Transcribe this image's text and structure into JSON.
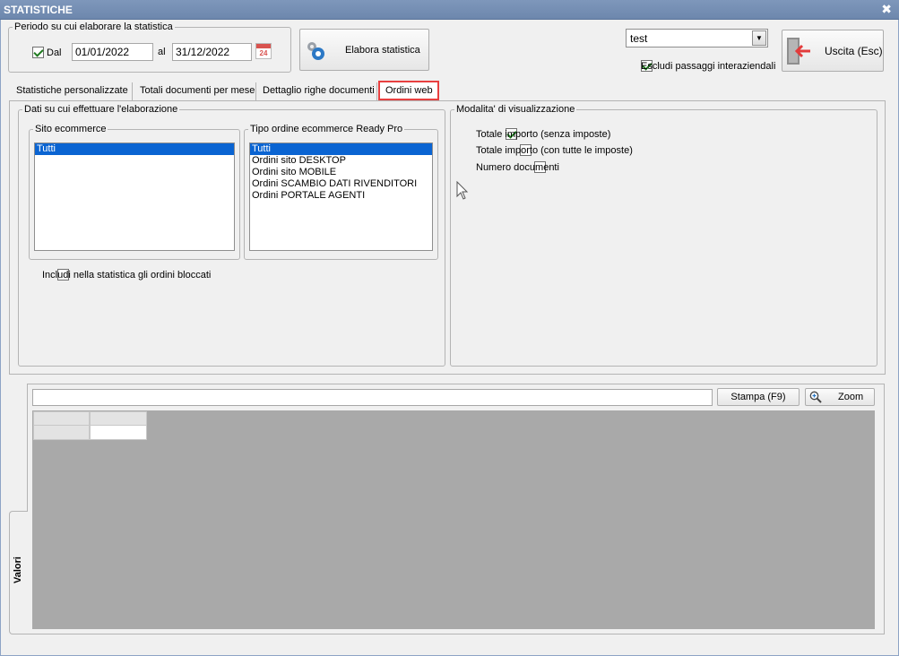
{
  "window": {
    "title": "STATISTICHE",
    "close_glyph": "✖"
  },
  "period": {
    "legend": "Periodo su cui elaborare la statistica",
    "dal_checked": true,
    "dal_label": "Dal",
    "date_from": "01/01/2022",
    "al_label": "al",
    "date_to": "31/12/2022",
    "calendar_number": "24"
  },
  "toolbar": {
    "elabora_label": "Elabora statistica",
    "company_select": "test",
    "escludi_checked": true,
    "escludi_label": "Escludi passaggi interaziendali",
    "exit_label": "Uscita (Esc)"
  },
  "tabs": [
    {
      "label": "Statistiche personalizzate",
      "active": false
    },
    {
      "label": "Totali documenti per mese",
      "active": false
    },
    {
      "label": "Dettaglio righe documenti",
      "active": false
    },
    {
      "label": "Ordini web",
      "active": true
    }
  ],
  "dati": {
    "legend": "Dati su cui effettuare l'elaborazione",
    "sito": {
      "legend": "Sito ecommerce",
      "items": [
        {
          "label": "Tutti",
          "selected": true
        }
      ]
    },
    "tipo": {
      "legend": "Tipo ordine ecommerce Ready Pro",
      "items": [
        {
          "label": "Tutti",
          "selected": true
        },
        {
          "label": "Ordini sito DESKTOP",
          "selected": false
        },
        {
          "label": "Ordini sito MOBILE",
          "selected": false
        },
        {
          "label": "Ordini SCAMBIO DATI RIVENDITORI",
          "selected": false
        },
        {
          "label": "Ordini PORTALE AGENTI",
          "selected": false
        }
      ]
    },
    "includi_checked": false,
    "includi_label": "Includi nella statistica gli ordini bloccati"
  },
  "modalita": {
    "legend": "Modalita' di visualizzazione",
    "options": [
      {
        "label": "Totale importo (senza imposte)",
        "checked": true
      },
      {
        "label": "Totale importo (con tutte le imposte)",
        "checked": false
      },
      {
        "label": "Numero documenti",
        "checked": false
      }
    ]
  },
  "results": {
    "search_value": "",
    "stampa_label": "Stampa (F9)",
    "zoom_label": "Zoom",
    "side_tab_label": "Valori"
  },
  "colors": {
    "highlight_red": "#e84040",
    "selection_blue": "#0a64d2",
    "title_blue": "#6d87ad"
  }
}
